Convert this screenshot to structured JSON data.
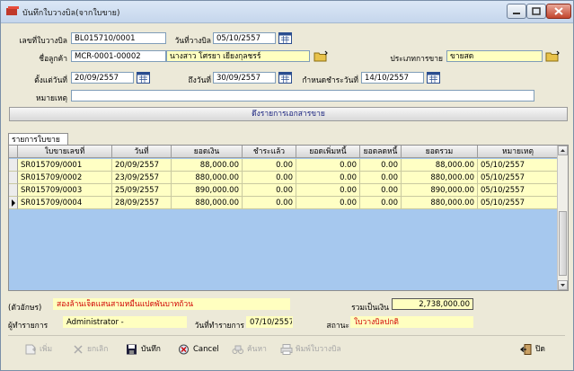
{
  "window": {
    "title": "บันทึกใบวางบิล(จากใบขาย)"
  },
  "form": {
    "bill_no_label": "เลขที่ใบวางบิล",
    "bill_no": "BL015710/0001",
    "bill_date_label": "วันที่วางบิล",
    "bill_date": "05/10/2557",
    "customer_label": "ชื่อลูกค้า",
    "customer_code": "MCR-0001-00002",
    "customer_name": "นางสาว โศรยา เยียงกุลชรร์",
    "sale_type_label": "ประเภทการขาย",
    "sale_type": "ขายสด",
    "from_date_label": "ตั้งแต่วันที่",
    "from_date": "20/09/2557",
    "to_date_label": "ถึงวันที่",
    "to_date": "30/09/2557",
    "due_date_label": "กำหนดชำระวันที่",
    "due_date": "14/10/2557",
    "note_label": "หมายเหตุ",
    "note": ""
  },
  "fetch_button": "ดึงรายการเอกสารขาย",
  "tab_label": "รายการใบขาย",
  "grid": {
    "columns": [
      "ใบขายเลขที่",
      "วันที่",
      "ยอดเงิน",
      "ชำระแล้ว",
      "ยอดเพิ่มหนี้",
      "ยอดลดหนี้",
      "ยอดรวม",
      "หมายเหตุ"
    ],
    "rows": [
      {
        "doc": "SR015709/0001",
        "date": "20/09/2557",
        "amount": "88,000.00",
        "paid": "0.00",
        "debit": "0.00",
        "credit": "0.00",
        "total": "88,000.00",
        "note": "05/10/2557"
      },
      {
        "doc": "SR015709/0002",
        "date": "23/09/2557",
        "amount": "880,000.00",
        "paid": "0.00",
        "debit": "0.00",
        "credit": "0.00",
        "total": "880,000.00",
        "note": "05/10/2557"
      },
      {
        "doc": "SR015709/0003",
        "date": "25/09/2557",
        "amount": "890,000.00",
        "paid": "0.00",
        "debit": "0.00",
        "credit": "0.00",
        "total": "890,000.00",
        "note": "05/10/2557"
      },
      {
        "doc": "SR015709/0004",
        "date": "28/09/2557",
        "amount": "880,000.00",
        "paid": "0.00",
        "debit": "0.00",
        "credit": "0.00",
        "total": "880,000.00",
        "note": "05/10/2557"
      }
    ]
  },
  "summary": {
    "text_label": "(ตัวอักษร)",
    "text_amount": "สองล้านเจ็ดแสนสามหมื่นแปดพันบาทถ้วน",
    "total_label": "รวมเป็นเงิน",
    "total": "2,738,000.00",
    "recorder_label": "ผู้ทำรายการ",
    "recorder": "Administrator -",
    "record_date_label": "วันที่ทำรายการ",
    "record_date": "07/10/2557",
    "status_label": "สถานะ",
    "status": "ใบวางบิลปกติ"
  },
  "toolbar": {
    "add": "เพิ่ม",
    "cancel_doc": "ยกเลิก",
    "save": "บันทึก",
    "cancel": "Cancel",
    "find": "ค้นหา",
    "print": "พิมพ์ใบวางบิล",
    "close": "ปิด"
  },
  "colors": {
    "field_yellow": "#ffffc0",
    "grid_background": "#a6c8ee",
    "status_red": "#d00000"
  }
}
